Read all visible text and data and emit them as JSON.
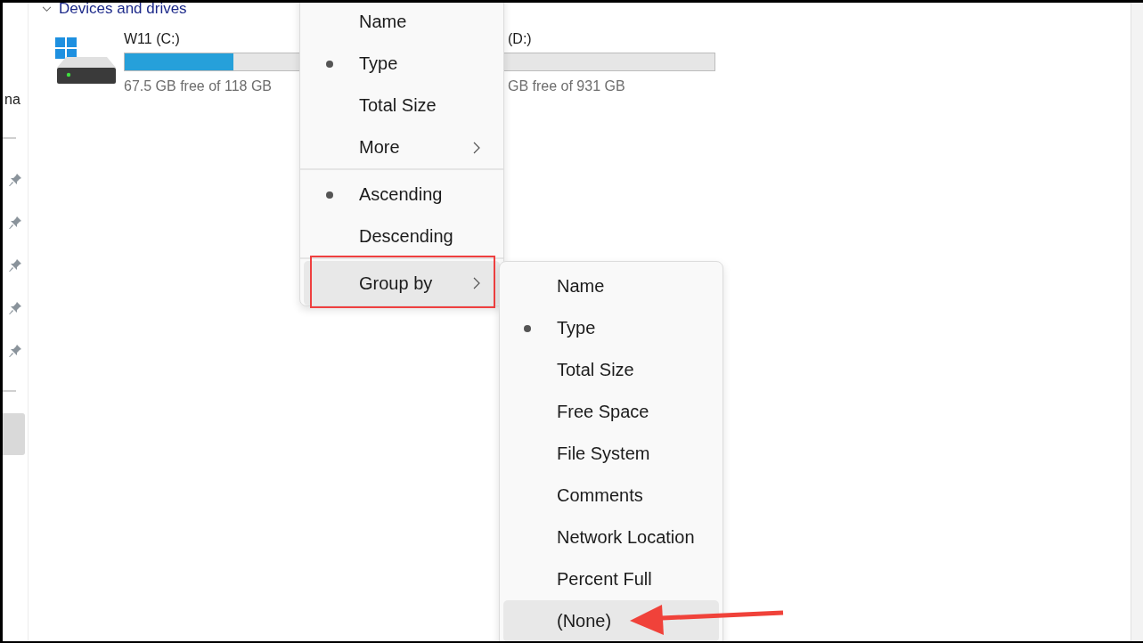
{
  "sidebar": {
    "partial_label": "na"
  },
  "section": {
    "title": "Devices and drives",
    "expanded": true
  },
  "drives": [
    {
      "name": "W11 (C:)",
      "level": 0.43,
      "free": "67.5 GB free of 118 GB"
    },
    {
      "name": "(D:)",
      "free": "GB free of 931 GB"
    }
  ],
  "context_menu": {
    "items": [
      {
        "kind": "option",
        "label": "Name",
        "selected": false
      },
      {
        "kind": "option",
        "label": "Type",
        "selected": true
      },
      {
        "kind": "option",
        "label": "Total Size",
        "selected": false
      },
      {
        "kind": "submenu",
        "label": "More",
        "highlighted": false
      },
      {
        "kind": "separator"
      },
      {
        "kind": "option",
        "label": "Ascending",
        "selected": true
      },
      {
        "kind": "option",
        "label": "Descending",
        "selected": false
      },
      {
        "kind": "separator"
      },
      {
        "kind": "submenu",
        "label": "Group by",
        "highlighted": true
      }
    ]
  },
  "submenu": {
    "items": [
      {
        "label": "Name",
        "selected": false,
        "highlighted": false
      },
      {
        "label": "Type",
        "selected": true,
        "highlighted": false
      },
      {
        "label": "Total Size",
        "selected": false,
        "highlighted": false
      },
      {
        "label": "Free Space",
        "selected": false,
        "highlighted": false
      },
      {
        "label": "File System",
        "selected": false,
        "highlighted": false
      },
      {
        "label": "Comments",
        "selected": false,
        "highlighted": false
      },
      {
        "label": "Network Location",
        "selected": false,
        "highlighted": false
      },
      {
        "label": "Percent Full",
        "selected": false,
        "highlighted": false
      },
      {
        "label": "(None)",
        "selected": false,
        "highlighted": true
      }
    ]
  }
}
